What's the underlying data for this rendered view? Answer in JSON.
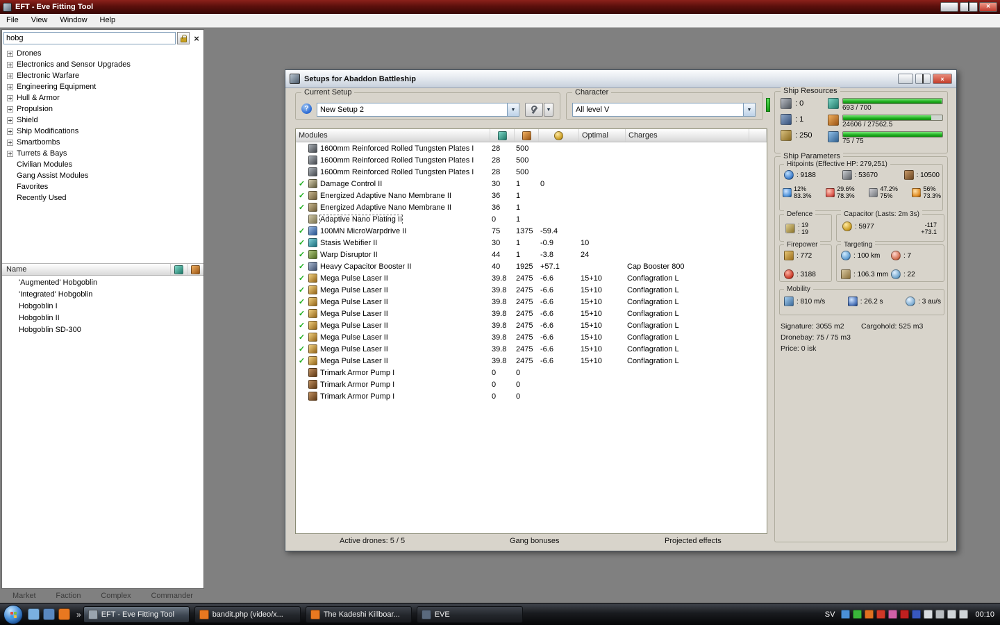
{
  "titlebar": {
    "title": "EFT - Eve Fitting Tool"
  },
  "menu": {
    "items": [
      "File",
      "View",
      "Window",
      "Help"
    ]
  },
  "browser": {
    "search_value": "hobg",
    "tree": [
      {
        "label": "Drones",
        "expandable": true
      },
      {
        "label": "Electronics and Sensor Upgrades",
        "expandable": true
      },
      {
        "label": "Electronic Warfare",
        "expandable": true
      },
      {
        "label": "Engineering Equipment",
        "expandable": true
      },
      {
        "label": "Hull & Armor",
        "expandable": true
      },
      {
        "label": "Propulsion",
        "expandable": true
      },
      {
        "label": "Shield",
        "expandable": true
      },
      {
        "label": "Ship Modifications",
        "expandable": true
      },
      {
        "label": "Smartbombs",
        "expandable": true
      },
      {
        "label": "Turrets & Bays",
        "expandable": true
      },
      {
        "label": "Civilian Modules",
        "expandable": false
      },
      {
        "label": "Gang Assist Modules",
        "expandable": false
      },
      {
        "label": "Favorites",
        "expandable": false
      },
      {
        "label": "Recently Used",
        "expandable": false
      }
    ],
    "results_header": "Name",
    "results": [
      "'Augmented' Hobgoblin",
      "'Integrated' Hobgoblin",
      "Hobgoblin I",
      "Hobgoblin II",
      "Hobgoblin SD-300"
    ],
    "tabs": [
      "Market",
      "Faction",
      "Complex",
      "Commander"
    ]
  },
  "setup_window": {
    "title": "Setups for Abaddon Battleship",
    "current_setup": {
      "label": "Current Setup",
      "value": "New Setup 2"
    },
    "character": {
      "label": "Character",
      "value": "All level V"
    },
    "resources": {
      "label": "Ship Resources",
      "slots": [
        {
          "icon": "turret-icon",
          "value": ": 0"
        },
        {
          "icon": "launcher-icon",
          "value": ": 1"
        },
        {
          "icon": "calibration-icon",
          "value": ": 250"
        }
      ],
      "bars": [
        {
          "icon": "cpu-icon",
          "value": "693 / 700",
          "pct": "99%"
        },
        {
          "icon": "powergrid-icon",
          "value": "24606 / 27562.5",
          "pct": "89%"
        },
        {
          "icon": "dronebay-icon",
          "value": "75 / 75",
          "pct": "100%"
        }
      ]
    },
    "table": {
      "headers": {
        "modules": "Modules",
        "optimal": "Optimal",
        "charges": "Charges"
      },
      "rows": [
        {
          "check": false,
          "icon": "armor-plate-icon",
          "name": "1600mm Reinforced Rolled Tungsten Plates I",
          "cpu": "28",
          "pg": "500",
          "cap": "",
          "optimal": "",
          "charge": ""
        },
        {
          "check": false,
          "icon": "armor-plate-icon",
          "name": "1600mm Reinforced Rolled Tungsten Plates I",
          "cpu": "28",
          "pg": "500",
          "cap": "",
          "optimal": "",
          "charge": ""
        },
        {
          "check": false,
          "icon": "armor-plate-icon",
          "name": "1600mm Reinforced Rolled Tungsten Plates I",
          "cpu": "28",
          "pg": "500",
          "cap": "",
          "optimal": "",
          "charge": ""
        },
        {
          "check": true,
          "icon": "damage-control-icon",
          "name": "Damage Control II",
          "cpu": "30",
          "pg": "1",
          "cap": "0",
          "optimal": "",
          "charge": ""
        },
        {
          "check": true,
          "icon": "nano-membrane-icon",
          "name": "Energized Adaptive Nano Membrane II",
          "cpu": "36",
          "pg": "1",
          "cap": "",
          "optimal": "",
          "charge": ""
        },
        {
          "check": true,
          "icon": "nano-membrane-icon",
          "name": "Energized Adaptive Nano Membrane II",
          "cpu": "36",
          "pg": "1",
          "cap": "",
          "optimal": "",
          "charge": ""
        },
        {
          "check": false,
          "icon": "nano-plating-icon",
          "name": "Adaptive Nano Plating II",
          "cpu": "0",
          "pg": "1",
          "cap": "",
          "optimal": "",
          "charge": "",
          "cls": "selected-name"
        },
        {
          "check": true,
          "icon": "mwd-icon",
          "name": "100MN MicroWarpdrive II",
          "cpu": "75",
          "pg": "1375",
          "cap": "-59.4",
          "optimal": "",
          "charge": ""
        },
        {
          "check": true,
          "icon": "web-icon",
          "name": "Stasis Webifier II",
          "cpu": "30",
          "pg": "1",
          "cap": "-0.9",
          "optimal": "10",
          "charge": ""
        },
        {
          "check": true,
          "icon": "disruptor-icon",
          "name": "Warp Disruptor II",
          "cpu": "44",
          "pg": "1",
          "cap": "-3.8",
          "optimal": "24",
          "charge": ""
        },
        {
          "check": true,
          "icon": "cap-booster-icon",
          "name": "Heavy Capacitor Booster II",
          "cpu": "40",
          "pg": "1925",
          "cap": "+57.1",
          "optimal": "",
          "charge": "Cap Booster 800"
        },
        {
          "check": true,
          "icon": "laser-icon",
          "name": "Mega Pulse Laser II",
          "cpu": "39.8",
          "pg": "2475",
          "cap": "-6.6",
          "optimal": "15+10",
          "charge": "Conflagration L"
        },
        {
          "check": true,
          "icon": "laser-icon",
          "name": "Mega Pulse Laser II",
          "cpu": "39.8",
          "pg": "2475",
          "cap": "-6.6",
          "optimal": "15+10",
          "charge": "Conflagration L"
        },
        {
          "check": true,
          "icon": "laser-icon",
          "name": "Mega Pulse Laser II",
          "cpu": "39.8",
          "pg": "2475",
          "cap": "-6.6",
          "optimal": "15+10",
          "charge": "Conflagration L"
        },
        {
          "check": true,
          "icon": "laser-icon",
          "name": "Mega Pulse Laser II",
          "cpu": "39.8",
          "pg": "2475",
          "cap": "-6.6",
          "optimal": "15+10",
          "charge": "Conflagration L"
        },
        {
          "check": true,
          "icon": "laser-icon",
          "name": "Mega Pulse Laser II",
          "cpu": "39.8",
          "pg": "2475",
          "cap": "-6.6",
          "optimal": "15+10",
          "charge": "Conflagration L"
        },
        {
          "check": true,
          "icon": "laser-icon",
          "name": "Mega Pulse Laser II",
          "cpu": "39.8",
          "pg": "2475",
          "cap": "-6.6",
          "optimal": "15+10",
          "charge": "Conflagration L"
        },
        {
          "check": true,
          "icon": "laser-icon",
          "name": "Mega Pulse Laser II",
          "cpu": "39.8",
          "pg": "2475",
          "cap": "-6.6",
          "optimal": "15+10",
          "charge": "Conflagration L"
        },
        {
          "check": true,
          "icon": "laser-icon",
          "name": "Mega Pulse Laser II",
          "cpu": "39.8",
          "pg": "2475",
          "cap": "-6.6",
          "optimal": "15+10",
          "charge": "Conflagration L"
        },
        {
          "check": false,
          "icon": "rig-icon",
          "name": "Trimark Armor Pump I",
          "cpu": "0",
          "pg": "0",
          "cap": "",
          "optimal": "",
          "charge": ""
        },
        {
          "check": false,
          "icon": "rig-icon",
          "name": "Trimark Armor Pump I",
          "cpu": "0",
          "pg": "0",
          "cap": "",
          "optimal": "",
          "charge": ""
        },
        {
          "check": false,
          "icon": "rig-icon",
          "name": "Trimark Armor Pump I",
          "cpu": "0",
          "pg": "0",
          "cap": "",
          "optimal": "",
          "charge": ""
        }
      ]
    },
    "footer": {
      "active_drones": "Active drones: 5 / 5",
      "gang": "Gang bonuses",
      "projected": "Projected effects"
    },
    "parameters": {
      "label": "Ship Parameters",
      "hitpoints": {
        "label": "Hitpoints (Effective HP: 279,251)",
        "stats": [
          {
            "icon": "shield-icon",
            "value": ": 9188"
          },
          {
            "icon": "armor-icon",
            "value": ": 53670"
          },
          {
            "icon": "hull-icon",
            "value": ": 10500"
          }
        ],
        "resists": [
          {
            "icon": "em-resist-icon",
            "top": "12%",
            "bottom": "83.3%"
          },
          {
            "icon": "thermal-resist-icon",
            "top": "29.6%",
            "bottom": "78.3%"
          },
          {
            "icon": "kinetic-resist-icon",
            "top": "47.2%",
            "bottom": "75%"
          },
          {
            "icon": "explosive-resist-icon",
            "top": "56%",
            "bottom": "73.3%"
          }
        ]
      },
      "defence": {
        "label": "Defence",
        "value1": ": 19",
        "value2": ": 19"
      },
      "capacitor": {
        "label": "Capacitor (Lasts: 2m 3s)",
        "amount": ": 5977",
        "drain": "-117",
        "peak": "+73.1"
      },
      "firepower": {
        "label": "Firepower",
        "values": [
          {
            "icon": "volley-icon",
            "value": ": 772"
          },
          {
            "icon": "dps-icon",
            "value": ": 3188"
          }
        ]
      },
      "targeting": {
        "label": "Targeting",
        "values": [
          {
            "icon": "range-icon",
            "value": ": 100 km"
          },
          {
            "icon": "max-targets-icon",
            "value": ": 7"
          },
          {
            "icon": "resolution-icon",
            "value": ": 106.3 mm"
          },
          {
            "icon": "sensor-strength-icon",
            "value": ": 22"
          }
        ]
      },
      "mobility": {
        "label": "Mobility",
        "values": [
          {
            "icon": "speed-icon",
            "value": ": 810 m/s"
          },
          {
            "icon": "agility-icon",
            "value": ": 26.2 s"
          },
          {
            "icon": "warp-speed-icon",
            "value": ": 3 au/s"
          }
        ]
      },
      "summary": {
        "signature": "Signature: 3055 m2",
        "cargohold": "Cargohold: 525 m3",
        "dronebay": "Dronebay: 75 / 75 m3",
        "price": "Price: 0 isk"
      }
    }
  },
  "taskbar": {
    "quick_launch": [
      {
        "name": "show-desktop-icon",
        "color": "#7ab0e0"
      },
      {
        "name": "window-switcher-icon",
        "color": "#5a88c0"
      },
      {
        "name": "firefox-icon",
        "color": "#e87820"
      }
    ],
    "buttons": [
      {
        "label": "EFT - Eve Fitting Tool",
        "icon": "eft-window-icon",
        "icon_color": "#9aa4ae",
        "cls": "active"
      },
      {
        "label": "bandit.php (video/x...",
        "icon": "firefox-icon",
        "icon_color": "#e87820",
        "cls": ""
      },
      {
        "label": "The Kadeshi Killboar...",
        "icon": "firefox-icon",
        "icon_color": "#e87820",
        "cls": ""
      },
      {
        "label": "EVE",
        "icon": "eve-icon",
        "icon_color": "#5a6a7e",
        "cls": ""
      }
    ],
    "language": "SV",
    "tray_icons": [
      {
        "name": "messenger-icon",
        "color": "#4a90d8"
      },
      {
        "name": "status-green-icon",
        "color": "#3ab53a"
      },
      {
        "name": "chat-icon",
        "color": "#e07020"
      },
      {
        "name": "media-player-icon",
        "color": "#d03828"
      },
      {
        "name": "pink-app-icon",
        "color": "#d060a8"
      },
      {
        "name": "alert-icon",
        "color": "#c02020"
      },
      {
        "name": "blue-tool-icon",
        "color": "#3858c0"
      },
      {
        "name": "keyboard-layout-icon",
        "color": "#d8dce0"
      },
      {
        "name": "eject-icon",
        "color": "#b8bcc0"
      },
      {
        "name": "network-icon",
        "color": "#cfd4d8"
      },
      {
        "name": "volume-icon",
        "color": "#cfd4d8"
      }
    ],
    "time": "00:10"
  }
}
